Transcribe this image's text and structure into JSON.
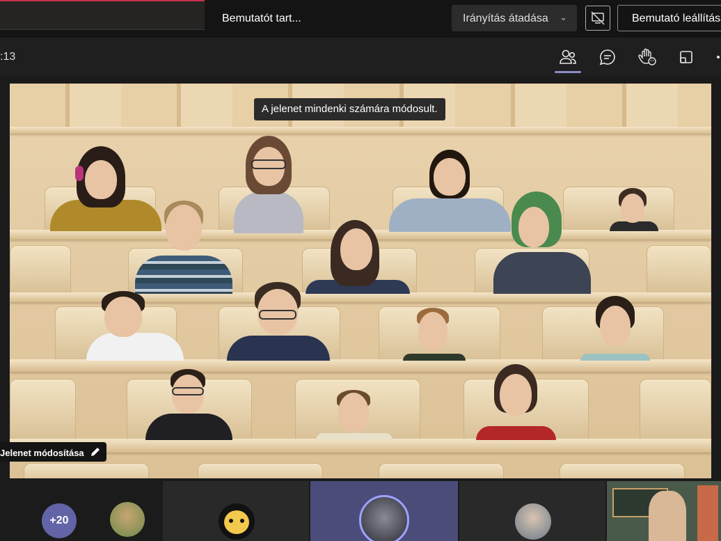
{
  "presenter_bar": {
    "status": "Bemutatót tart...",
    "handover_label": "Irányítás átadása",
    "stop_label": "Bemutató leállítása"
  },
  "meeting": {
    "timer": ":13",
    "toolbar_icons": [
      "people-icon",
      "chat-icon",
      "raise-hand-icon",
      "rooms-icon",
      "more-icon"
    ]
  },
  "stage": {
    "toast": "A jelenet mindenki számára módosult.",
    "scene_button": "Jelenet módosítása"
  },
  "strip": {
    "more_count": "+20",
    "accent": "#6264a7"
  },
  "colors": {
    "active_indicator": "#8b8cc7",
    "wood": "#e0c89f",
    "danger": "#c4314b"
  }
}
